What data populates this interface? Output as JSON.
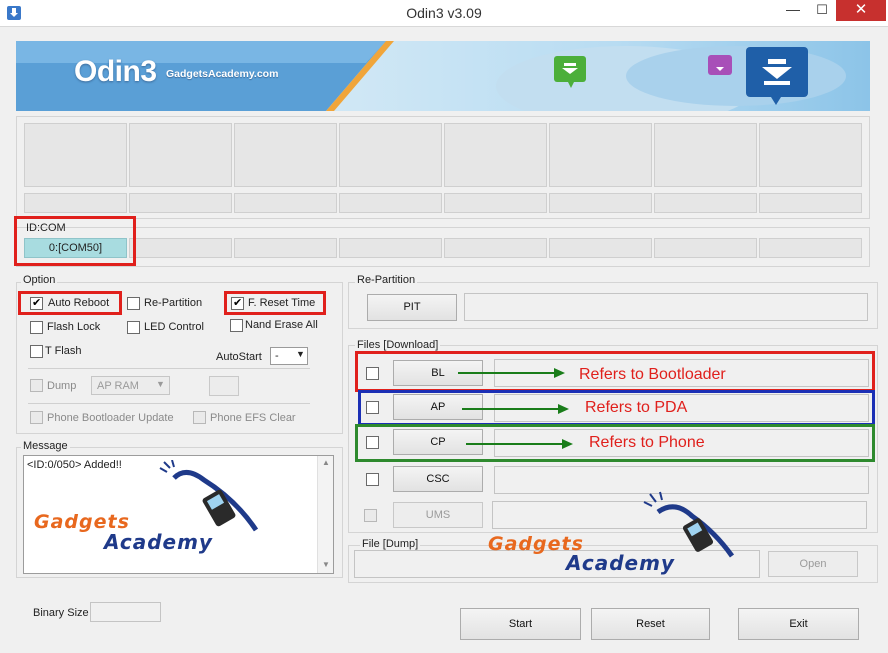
{
  "window": {
    "title": "Odin3 v3.09",
    "minimize": "—",
    "maximize": "☐",
    "close": "✕"
  },
  "banner": {
    "logo": "Odin3",
    "site": "GadgetsAcademy.com"
  },
  "idcom": {
    "label": "ID:COM",
    "port": "0:[COM50]"
  },
  "option": {
    "label": "Option",
    "auto_reboot": "Auto Reboot",
    "re_partition": "Re-Partition",
    "f_reset_time": "F. Reset Time",
    "flash_lock": "Flash Lock",
    "led_control": "LED Control",
    "nand_erase_all": "Nand Erase All",
    "t_flash": "T Flash",
    "autostart_label": "AutoStart",
    "autostart_value": "-",
    "dump_label": "Dump",
    "dump_value": "AP RAM",
    "phone_bootloader_update": "Phone Bootloader Update",
    "phone_efs_clear": "Phone EFS Clear"
  },
  "message": {
    "label": "Message",
    "text": "<ID:0/050> Added!!"
  },
  "watermark": {
    "top": "Gadgets",
    "bottom": "Academy"
  },
  "repartition": {
    "label": "Re-Partition",
    "pit_button": "PIT"
  },
  "files": {
    "label": "Files [Download]",
    "bl": "BL",
    "ap": "AP",
    "cp": "CP",
    "csc": "CSC",
    "ums": "UMS"
  },
  "annotations": {
    "bl": "Refers to Bootloader",
    "ap": "Refers to PDA",
    "cp": "Refers to Phone"
  },
  "dump": {
    "label": "File [Dump]",
    "open_button": "Open"
  },
  "binary": {
    "label": "Binary Size"
  },
  "actions": {
    "start": "Start",
    "reset": "Reset",
    "exit": "Exit"
  },
  "colors": {
    "highlight_red": "#e0201c",
    "highlight_blue": "#1b2fb5",
    "highlight_green": "#2e8a2e",
    "arrow": "#1a7d1a",
    "port_cell": "#a8dce0"
  }
}
